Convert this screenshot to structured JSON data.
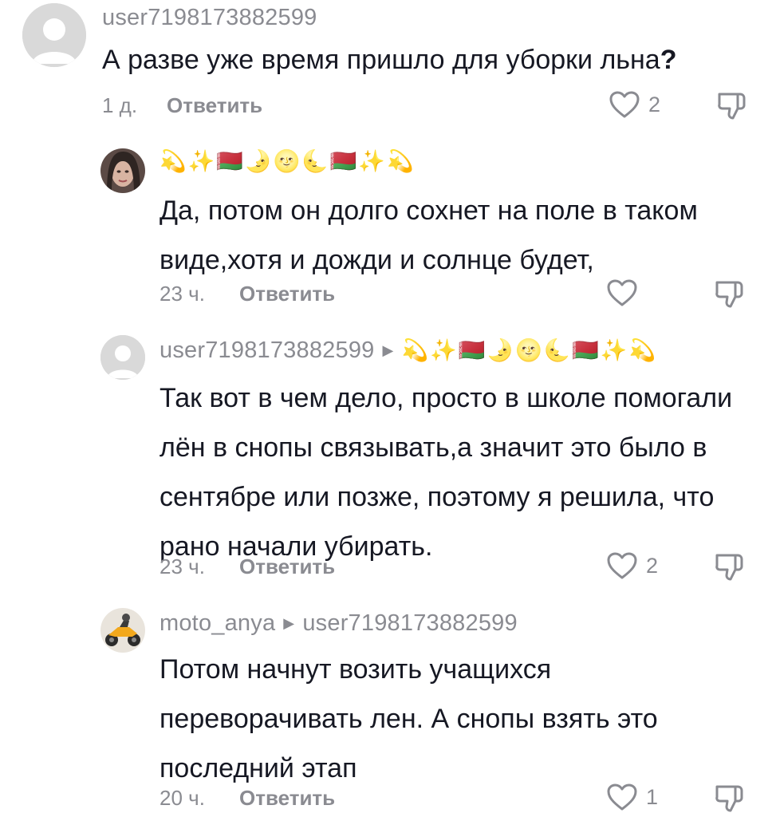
{
  "comments": [
    {
      "username": "user7198173882599",
      "text": "А разве уже время пришло для уборки льна",
      "text_end": "?",
      "time": "1 д.",
      "reply_label": "Ответить",
      "likes": "2"
    },
    {
      "username_emoji": "💫✨🇧🇾🌛🌝🌜🇧🇾✨💫",
      "text": "Да, потом он долго сохнет на поле в таком виде,хотя и дожди и солнце будет,",
      "time": "23 ч.",
      "reply_label": "Ответить",
      "likes": ""
    },
    {
      "username": "user7198173882599",
      "reply_to_emoji": "💫✨🇧🇾🌛🌝🌜🇧🇾✨💫",
      "text": "Так вот в чем дело, просто в школе помогали лён в снопы связывать,а значит это было в сентябре или позже, поэтому я решила, что рано начали убирать.",
      "time": "23 ч.",
      "reply_label": "Ответить",
      "likes": "2"
    },
    {
      "username": "moto_anya",
      "reply_to": "user7198173882599",
      "text": "Потом начнут возить учащихся переворачивать лен. А снопы взять это последний этап",
      "time": "20 ч.",
      "reply_label": "Ответить",
      "likes": "1"
    }
  ],
  "icons": {
    "like": "heart-outline-icon",
    "dislike": "thumbs-down-icon",
    "reply_arrow": "triangle-right-icon"
  },
  "colors": {
    "text": "#161823",
    "secondary": "#8a8b91",
    "avatar_default": "#d9d9d9"
  }
}
